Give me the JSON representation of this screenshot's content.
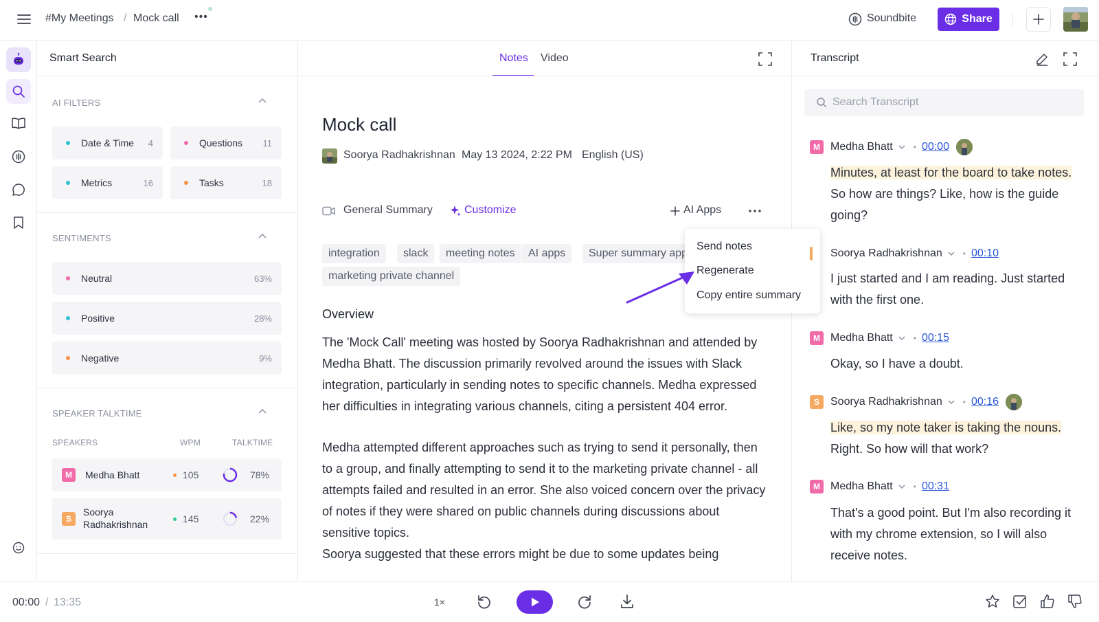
{
  "header": {
    "crumb_root": "#My Meetings",
    "crumb_sep": "/",
    "crumb_current": "Mock call",
    "more_label": "•••",
    "soundbite_label": "Soundbite",
    "share_label": "Share"
  },
  "smart_search": {
    "title": "Smart Search",
    "ai_filters": {
      "heading": "AI FILTERS",
      "items": [
        {
          "label": "Date & Time",
          "count": "4",
          "color": "#2ec4d6"
        },
        {
          "label": "Questions",
          "count": "11",
          "color": "#f06ba8"
        },
        {
          "label": "Metrics",
          "count": "16",
          "color": "#2ec4d6"
        },
        {
          "label": "Tasks",
          "count": "18",
          "color": "#f5924a"
        }
      ]
    },
    "sentiments": {
      "heading": "SENTIMENTS",
      "items": [
        {
          "label": "Neutral",
          "pct": "63%",
          "color": "#f06ba8"
        },
        {
          "label": "Positive",
          "pct": "28%",
          "color": "#2ec4d6"
        },
        {
          "label": "Negative",
          "pct": "9%",
          "color": "#f5924a"
        }
      ]
    },
    "talktime": {
      "heading": "SPEAKER TALKTIME",
      "col_speakers": "SPEAKERS",
      "col_wpm": "WPM",
      "col_talktime": "TALKTIME",
      "speakers": [
        {
          "initial": "M",
          "name": "Medha Bhatt",
          "wpm": "105",
          "talk": "78%",
          "talk_fraction": 0.78,
          "avatar_color": "#f06ba8",
          "dot_color": "#f5924a"
        },
        {
          "initial": "S",
          "name_line1": "Soorya",
          "name_line2": "Radhakrishnan",
          "wpm": "145",
          "talk": "22%",
          "talk_fraction": 0.22,
          "avatar_color": "#f5a860",
          "dot_color": "#2ecb8a"
        }
      ]
    }
  },
  "notes": {
    "tab_notes": "Notes",
    "tab_video": "Video",
    "title": "Mock call",
    "host": "Soorya Radhakrishnan",
    "date": "May 13 2024, 2:22 PM",
    "language": "English (US)",
    "summary_type": "General Summary",
    "customize": "Customize",
    "ai_apps": "AI Apps",
    "tags": [
      "integration",
      "slack",
      "meeting notes",
      "AI apps",
      "Super summary app",
      "marketing private channel"
    ],
    "overview_heading": "Overview",
    "para1": "The 'Mock Call' meeting was hosted by Soorya Radhakrishnan and attended by Medha Bhatt. The discussion primarily revolved around the issues with Slack integration, particularly in sending notes to specific channels. Medha expressed her difficulties in integrating various channels, citing a persistent 404 error.",
    "para2": "Medha attempted different approaches such as trying to send it personally, then to a group, and finally attempting to send it to the marketing private channel - all attempts failed and resulted in an error. She also voiced concern over the privacy of notes if they were shared on public channels during discussions about sensitive topics.",
    "para3": "Soorya suggested that these errors might be due to some updates being"
  },
  "menu": {
    "items": [
      "Send notes",
      "Regenerate",
      "Copy entire summary"
    ]
  },
  "transcript": {
    "title": "Transcript",
    "search_placeholder": "Search Transcript",
    "entries": [
      {
        "initial": "M",
        "speaker": "Medha Bhatt",
        "time": "00:00",
        "hl": "Minutes, at least for the board to take notes.",
        "rest": " So how are things? Like, how is the guide going?",
        "color": "#f06ba8"
      },
      {
        "initial": "S",
        "speaker": "Soorya Radhakrishnan",
        "time": "00:10",
        "hl": "",
        "rest": "I just started and I am reading. Just started with the first one.",
        "color": "#f5a860"
      },
      {
        "initial": "M",
        "speaker": "Medha Bhatt",
        "time": "00:15",
        "hl": "",
        "rest": "Okay, so I have a doubt.",
        "color": "#f06ba8"
      },
      {
        "initial": "S",
        "speaker": "Soorya Radhakrishnan",
        "time": "00:16",
        "hl": "Like, so my note taker is taking the nouns.",
        "rest": " Right. So how will that work?",
        "color": "#f5a860"
      },
      {
        "initial": "M",
        "speaker": "Medha Bhatt",
        "time": "00:31",
        "hl": "",
        "rest": "That's a good point. But I'm also recording it with my chrome extension, so I will also receive notes.",
        "color": "#f06ba8"
      }
    ]
  },
  "player": {
    "current": "00:00",
    "sep": "/",
    "total": "13:35",
    "speed": "1×"
  },
  "colors": {
    "accent": "#6a2ee6",
    "link": "#2855d8",
    "highlight": "#fdf3dc"
  }
}
